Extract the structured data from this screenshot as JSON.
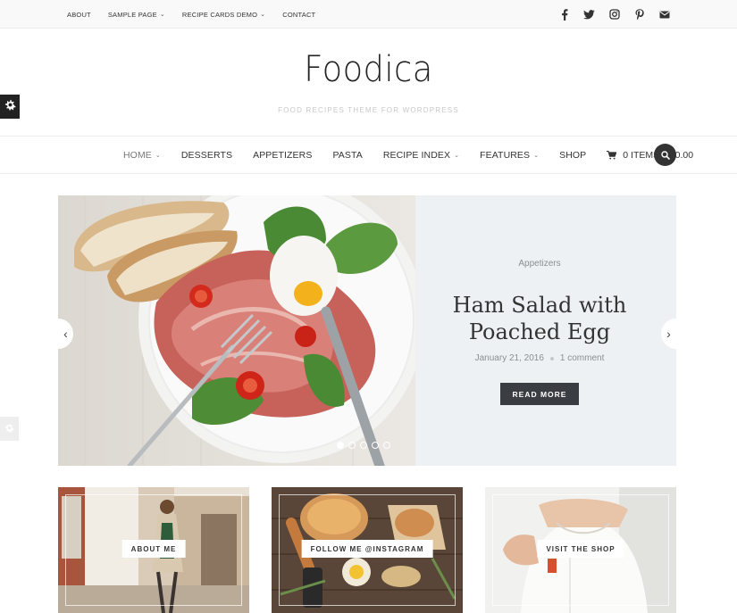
{
  "topbar": {
    "menu": [
      {
        "label": "About",
        "has_dropdown": false
      },
      {
        "label": "Sample Page",
        "has_dropdown": true
      },
      {
        "label": "Recipe Cards Demo",
        "has_dropdown": true
      },
      {
        "label": "Contact",
        "has_dropdown": false
      }
    ],
    "social_icons": [
      "facebook-icon",
      "twitter-icon",
      "instagram-icon",
      "pinterest-icon",
      "email-icon"
    ]
  },
  "brand": {
    "logo": "Foodica",
    "tagline": "Food Recipes Theme for WordPress"
  },
  "mainnav": {
    "items": [
      {
        "label": "Home",
        "has_dropdown": true,
        "active": true
      },
      {
        "label": "Desserts",
        "has_dropdown": false
      },
      {
        "label": "Appetizers",
        "has_dropdown": false
      },
      {
        "label": "Pasta",
        "has_dropdown": false
      },
      {
        "label": "Recipe Index",
        "has_dropdown": true
      },
      {
        "label": "Features",
        "has_dropdown": true
      },
      {
        "label": "Shop",
        "has_dropdown": false
      }
    ],
    "cart": "0 items – $0.00"
  },
  "slider": {
    "category": "Appetizers",
    "title_line1": "Ham Salad with",
    "title_line2": "Poached Egg",
    "date": "January 21, 2016",
    "comments": "1 comment",
    "button": "Read More",
    "slide_count": 5,
    "active_slide": 1
  },
  "promos": [
    {
      "label": "About Me"
    },
    {
      "label": "Follow Me @Instagram"
    },
    {
      "label": "Visit the Shop"
    }
  ],
  "colors": {
    "accent_dark": "#3a3e43",
    "slider_bg": "#eef1f3"
  }
}
